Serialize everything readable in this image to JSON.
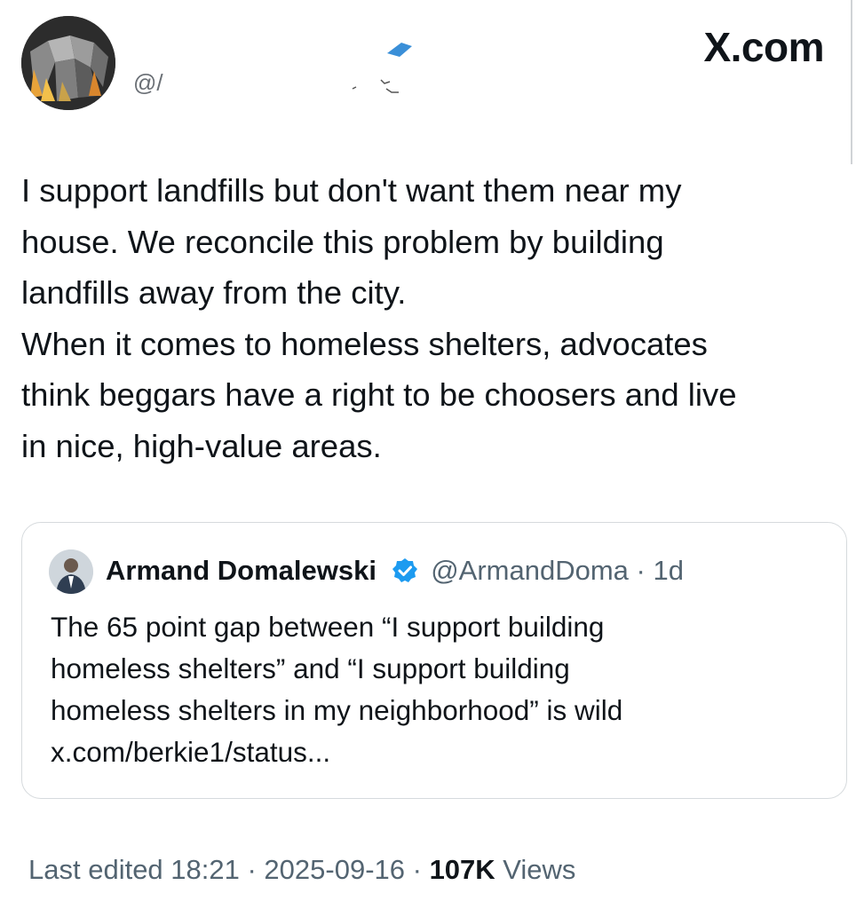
{
  "header": {
    "handle_prefix": "@/",
    "brand": "X.com"
  },
  "tweet": {
    "lines": [
      "I support landfills but don't want them near my",
      "house. We reconcile this problem by building",
      "landfills away from the city.",
      "When it comes to homeless shelters, advocates",
      "think beggars have a right to be choosers and live",
      "in nice, high-value areas."
    ]
  },
  "quote": {
    "name": "Armand Domalewski",
    "handle": "@ArmandDoma",
    "separator": "·",
    "age": "1d",
    "lines": [
      "The 65 point gap between “I support building",
      "homeless shelters” and “I support building",
      "homeless shelters in my neighborhood” is wild",
      "x.com/berkie1/status..."
    ]
  },
  "footer": {
    "edited_label": "Last edited 18:21",
    "dot1": " · ",
    "date": "2025-09-16",
    "dot2": " · ",
    "views_count": "107K",
    "views_label": "Views"
  },
  "colors": {
    "text": "#0f1419",
    "secondary": "#536471",
    "border": "#d6dadd",
    "verified": "#1d9bf0"
  },
  "icons": {
    "verified": "verified-badge-icon",
    "brand": "x-logo"
  }
}
